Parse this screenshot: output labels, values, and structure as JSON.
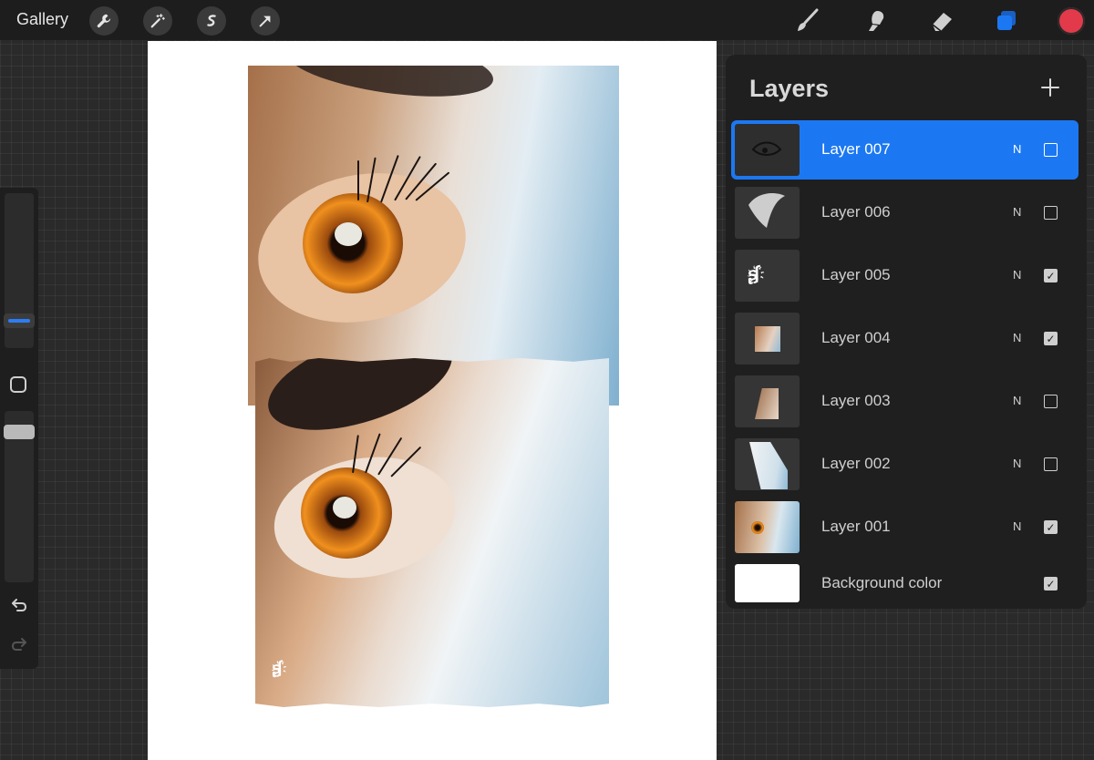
{
  "topbar": {
    "gallery_label": "Gallery",
    "left_tools": [
      "wrench-icon",
      "magic-wand-icon",
      "selection-s-icon",
      "transform-arrow-icon"
    ],
    "right_tools": [
      "brush-icon",
      "smudge-icon",
      "eraser-icon",
      "layers-icon"
    ],
    "active_color": "#e23a4b"
  },
  "layers_panel": {
    "title": "Layers",
    "layers": [
      {
        "name": "Layer 007",
        "blend": "N",
        "visible": false,
        "active": true
      },
      {
        "name": "Layer 006",
        "blend": "N",
        "visible": false,
        "active": false
      },
      {
        "name": "Layer 005",
        "blend": "N",
        "visible": true,
        "active": false
      },
      {
        "name": "Layer 004",
        "blend": "N",
        "visible": true,
        "active": false
      },
      {
        "name": "Layer 003",
        "blend": "N",
        "visible": false,
        "active": false
      },
      {
        "name": "Layer 002",
        "blend": "N",
        "visible": false,
        "active": false
      },
      {
        "name": "Layer 001",
        "blend": "N",
        "visible": true,
        "active": false
      }
    ],
    "background": {
      "name": "Background color",
      "visible": true,
      "color": "#ffffff"
    }
  },
  "colors": {
    "accent": "#1c78f2",
    "panel": "#1f1f1f",
    "topbar": "#1d1d1d"
  }
}
